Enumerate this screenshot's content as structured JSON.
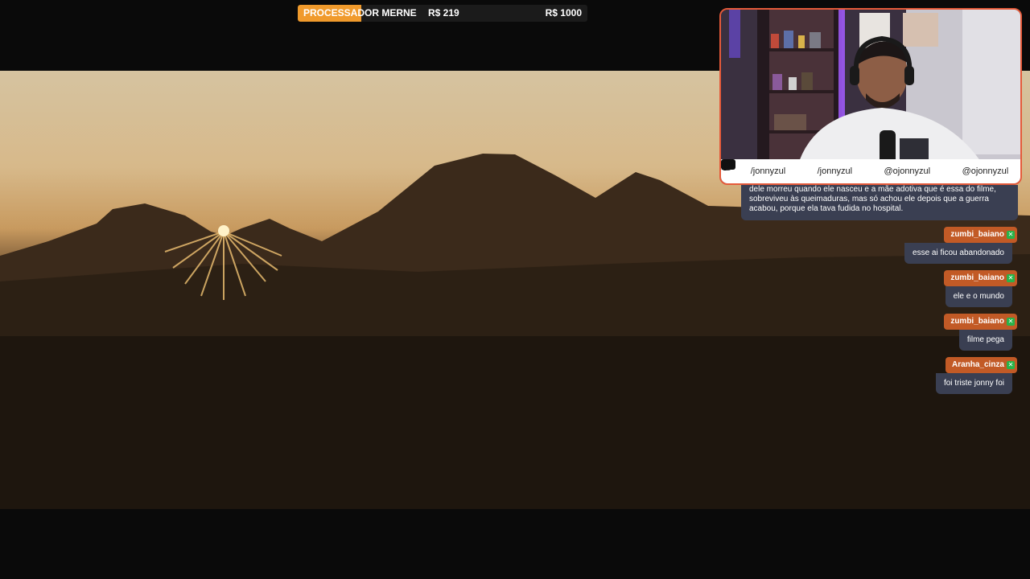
{
  "goal": {
    "title": "PROCESSADOR MERNE",
    "current": "R$ 219",
    "target": "R$ 1000",
    "progress_fraction": 0.219,
    "fill_color": "#f09a2c"
  },
  "webcam": {
    "border_color": "#e55a3a",
    "socials": [
      {
        "icon": "youtube-icon",
        "handle": "/jonnyzul"
      },
      {
        "icon": "facebook-icon",
        "handle": "/jonnyzul"
      },
      {
        "icon": "twitter-icon",
        "handle": "@ojonnyzul"
      },
      {
        "icon": "instagram-icon",
        "handle": "@ojonnyzul"
      }
    ]
  },
  "chat": {
    "first_message_lines": [
      "dele morreu quando ele nasceu e a mãe adotiva que é essa do filme,",
      "sobreviveu às queimaduras, mas só achou ele depois que a guerra",
      "acabou, porque ela tava fudida no hospital."
    ],
    "messages": [
      {
        "user": "zumbi_baiano",
        "text": "esse ai ficou abandonado"
      },
      {
        "user": "zumbi_baiano",
        "text": "ele e o mundo"
      },
      {
        "user": "zumbi_baiano",
        "text": "filme pega"
      },
      {
        "user": "Aranha_cinza",
        "text": "foi triste jonny foi"
      }
    ],
    "name_color": "#c25a26",
    "bubble_color": "#3a3f52",
    "badge_color": "#28b34a"
  }
}
